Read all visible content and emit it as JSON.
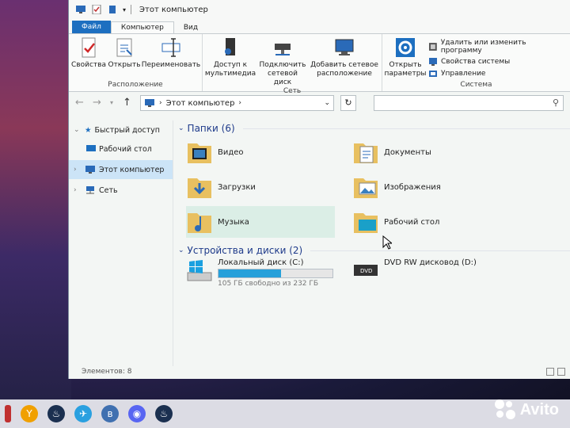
{
  "window": {
    "title": "Этот компьютер"
  },
  "ribbon": {
    "tabs": [
      "Файл",
      "Компьютер",
      "Вид"
    ],
    "groups": {
      "location": {
        "label": "Расположение",
        "buttons": [
          "Свойства",
          "Открыть",
          "Переименовать"
        ]
      },
      "network": {
        "label": "Сеть",
        "buttons": [
          "Доступ к\nмультимедиа",
          "Подключить\nсетевой диск",
          "Добавить сетевое\nрасположение"
        ]
      },
      "system": {
        "label": "Система",
        "open_params": "Открыть\nпараметры",
        "items": [
          "Удалить или изменить программу",
          "Свойства системы",
          "Управление"
        ]
      }
    }
  },
  "address": {
    "path": "Этот компьютер",
    "search_placeholder": ""
  },
  "nav": {
    "items": [
      {
        "label": "Быстрый доступ"
      },
      {
        "label": "Рабочий стол"
      },
      {
        "label": "Этот компьютер"
      },
      {
        "label": "Сеть"
      }
    ]
  },
  "folders": {
    "header": "Папки (6)",
    "items": [
      {
        "label": "Видео",
        "icon": "video-folder-icon"
      },
      {
        "label": "Документы",
        "icon": "documents-folder-icon"
      },
      {
        "label": "Загрузки",
        "icon": "downloads-folder-icon"
      },
      {
        "label": "Изображения",
        "icon": "pictures-folder-icon"
      },
      {
        "label": "Музыка",
        "icon": "music-folder-icon"
      },
      {
        "label": "Рабочий стол",
        "icon": "desktop-folder-icon"
      }
    ]
  },
  "drives": {
    "header": "Устройства и диски (2)",
    "items": [
      {
        "label": "Локальный диск (C:)",
        "free": "105 ГБ свободно из 232 ГБ",
        "used_fraction": 0.55
      },
      {
        "label": "DVD RW дисковод (D:)"
      }
    ]
  },
  "status": {
    "count": "Элементов: 8"
  },
  "watermark": {
    "text": "Avito"
  },
  "colors": {
    "accent": "#1d6fc0",
    "selection": "#cce4f7",
    "progress": "#26a0da"
  }
}
